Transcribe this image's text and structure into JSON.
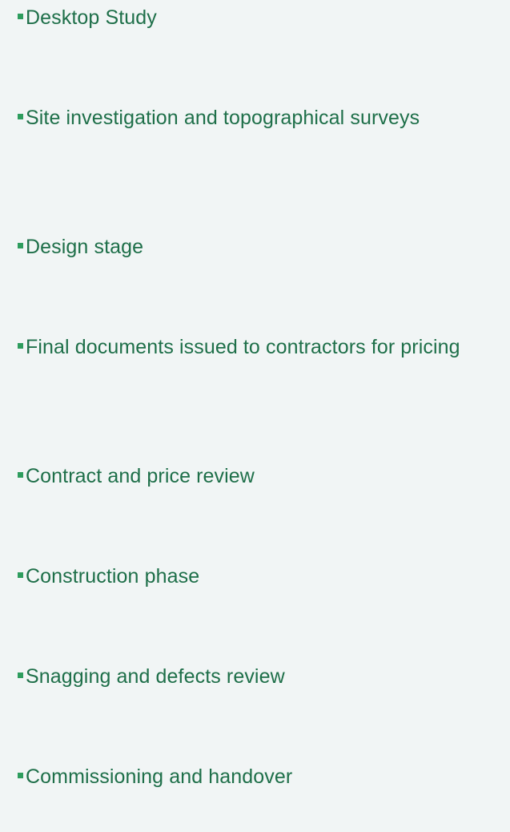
{
  "bullet_icon": "square-bullet-icon",
  "colors": {
    "background": "#f1f5f5",
    "text": "#1e6f49",
    "bullet": "#2e9d5e"
  },
  "items": [
    "Desktop Study",
    "Site investigation and topographical surveys",
    "Design stage",
    "Final documents issued to contractors for pricing",
    "Contract and price review",
    "Construction phase",
    "Snagging and defects review",
    "Commissioning and handover"
  ]
}
